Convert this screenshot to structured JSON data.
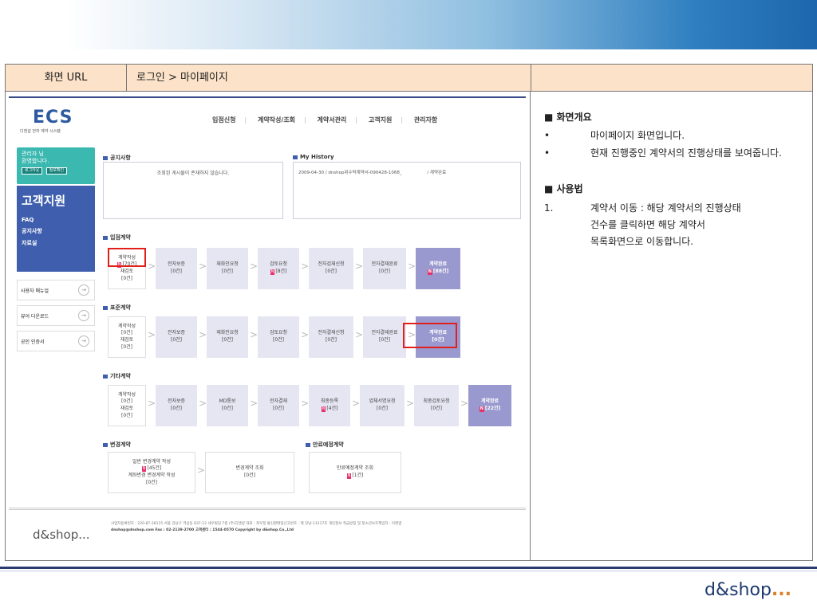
{
  "header": {
    "url_label": "화면 URL",
    "url_value": "로그인 > 마이페이지"
  },
  "mock": {
    "logo": "ECS",
    "logo_sub": "디앤샵 전자 계약 시스템",
    "nav": [
      "입점신청",
      "계약작성/조회",
      "계약서관리",
      "고객지원",
      "관리자함"
    ],
    "login": {
      "line1": "관리자 님",
      "line2": "환영합니다.",
      "btn1": "로그아웃",
      "btn2": "정보확인"
    },
    "side_title": "고객지원",
    "side_items": [
      "FAQ",
      "공지사항",
      "자료실"
    ],
    "side_links": [
      "사용자 매뉴얼",
      "뷰어 다운로드",
      "공인 인증서"
    ],
    "notice_title": "공지사항",
    "notice_text": "조회된 게시물이 존재하지 않습니다.",
    "history_title": "My History",
    "history_text": "2009-04-30 / dnshop위수탁계약서-090428-1068_",
    "history_status": "/   계약완료",
    "sec1": "입점계약",
    "sec2": "표준계약",
    "sec3": "기타계약",
    "sec4": "변경계약",
    "sec5": "만료예정계약",
    "row1": {
      "first": [
        "계약작성",
        "[70건]",
        "재검토",
        "[0건]"
      ],
      "steps": [
        [
          "전자보증",
          "[0건]"
        ],
        [
          "재화인요청",
          "[0건]"
        ],
        [
          "검토요청",
          "[8건]"
        ],
        [
          "전자검재신청",
          "[0건]"
        ],
        [
          "전자결재완료",
          "[0건]"
        ]
      ],
      "done": [
        "계약완료",
        "[88건]"
      ]
    },
    "row2": {
      "first": [
        "계약작성",
        "[0건]",
        "재검토",
        "[0건]"
      ],
      "steps": [
        [
          "전자보증",
          "[0건]"
        ],
        [
          "재화인요청",
          "[0건]"
        ],
        [
          "검토요청",
          "[0건]"
        ],
        [
          "전자결재신청",
          "[0건]"
        ],
        [
          "전자결재완료",
          "[0건]"
        ]
      ],
      "done": [
        "계약완료",
        "[0건]"
      ]
    },
    "row3": {
      "first": [
        "계약작성",
        "[0건]",
        "재검토",
        "[0건]"
      ],
      "steps": [
        [
          "전자보증",
          "[0건]"
        ],
        [
          "MD통보",
          "[0건]"
        ],
        [
          "전자결재",
          "[0건]"
        ],
        [
          "최종등록",
          "[4건]"
        ],
        [
          "업체서명요청",
          "[0건]"
        ],
        [
          "최종검토요청",
          "[0건]"
        ]
      ],
      "done": [
        "계약완료",
        "[22건]"
      ]
    },
    "change": {
      "a": "일반 변경계약 작성",
      "a_count": "[45건]",
      "b": "계좌변경 변경계약 작성",
      "b_count": "[0건]",
      "view": "변경계약 조회",
      "view_count": "[0건]"
    },
    "expire": {
      "view": "만료예정계약 조회",
      "count": "[1건]"
    },
    "footer_logo": "d&shop...",
    "footer_line1": "사업자등록번호 : 220-87-28115  서울 강남구 역삼동 837-12 세우빌딩 7층 (주)디앤샵  대표 : 최우정  통신판매업신고번호 : 제 강남-11217호 개인정보 취급방침 및 청소년보호책임자 : 이명엽",
    "footer_line2": "dnshop@dnshop.com Fax : 02-2139-2700 고객센터 : 1544-0570 Copyright by d&shop.Co.,Ltd"
  },
  "desc": {
    "head1": "■ 화면개요",
    "overview": [
      {
        "bullet": "•",
        "text": "마이페이지 화면입니다."
      },
      {
        "bullet": "•",
        "text": "현재 진행중인 계약서의 진행상태를 보여줍니다."
      }
    ],
    "head2": "■ 사용법",
    "usage_num": "1.",
    "usage_lines": [
      "계약서 이동 : 해당 계약서의 진행상태",
      "건수를 클릭하면 해당 계약서",
      "목록화면으로 이동합니다."
    ]
  },
  "brand": {
    "text": "d&shop",
    "dots": "..."
  }
}
